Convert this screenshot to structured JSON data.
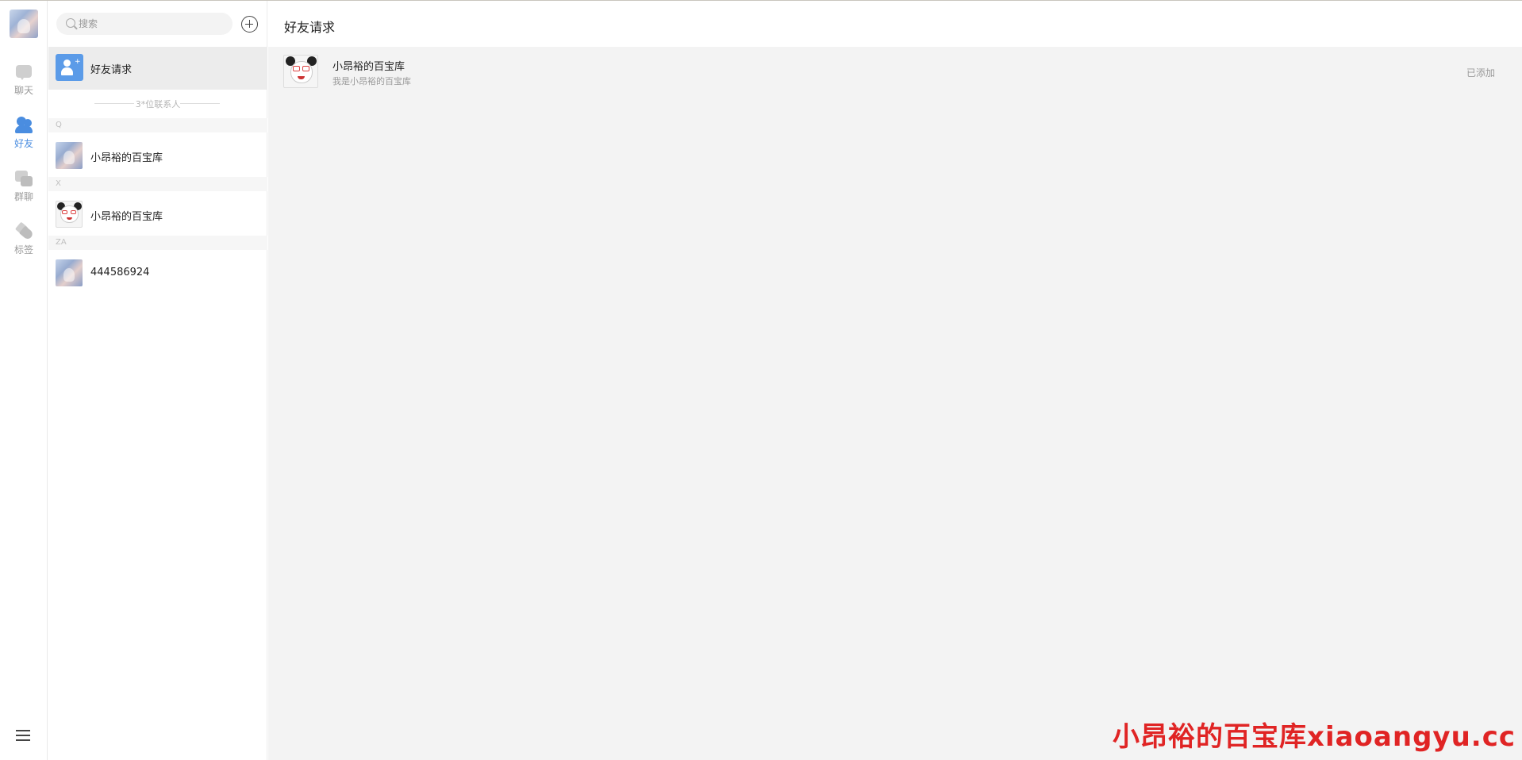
{
  "rail": {
    "nav": [
      {
        "label": "聊天",
        "icon": "chat-icon",
        "active": false
      },
      {
        "label": "好友",
        "icon": "friends-icon",
        "active": true
      },
      {
        "label": "群聊",
        "icon": "group-chat-icon",
        "active": false
      },
      {
        "label": "标签",
        "icon": "tag-icon",
        "active": false
      }
    ],
    "menu_icon": "hamburger-menu-icon"
  },
  "sidebar": {
    "search_placeholder": "搜索",
    "add_icon": "plus-circle-icon",
    "friend_request_label": "好友请求",
    "contact_count_label": "3*位联系人",
    "sections": [
      {
        "letter": "Q",
        "contacts": [
          {
            "name": "小昂裕的百宝库",
            "avatar": "sky"
          }
        ]
      },
      {
        "letter": "X",
        "contacts": [
          {
            "name": "小昂裕的百宝库",
            "avatar": "panda"
          }
        ]
      },
      {
        "letter": "ZA",
        "contacts": [
          {
            "name": "444586924",
            "avatar": "sky"
          }
        ]
      }
    ]
  },
  "main": {
    "title": "好友请求",
    "requests": [
      {
        "name": "小昂裕的百宝库",
        "message": "我是小昂裕的百宝库",
        "status": "已添加",
        "avatar": "panda"
      }
    ]
  },
  "watermark": "小昂裕的百宝库xiaoangyu.cc",
  "colors": {
    "accent": "#4a8de0",
    "request_icon": "#5b9be8",
    "watermark": "#e02424",
    "pane_bg": "#f3f3f3"
  }
}
